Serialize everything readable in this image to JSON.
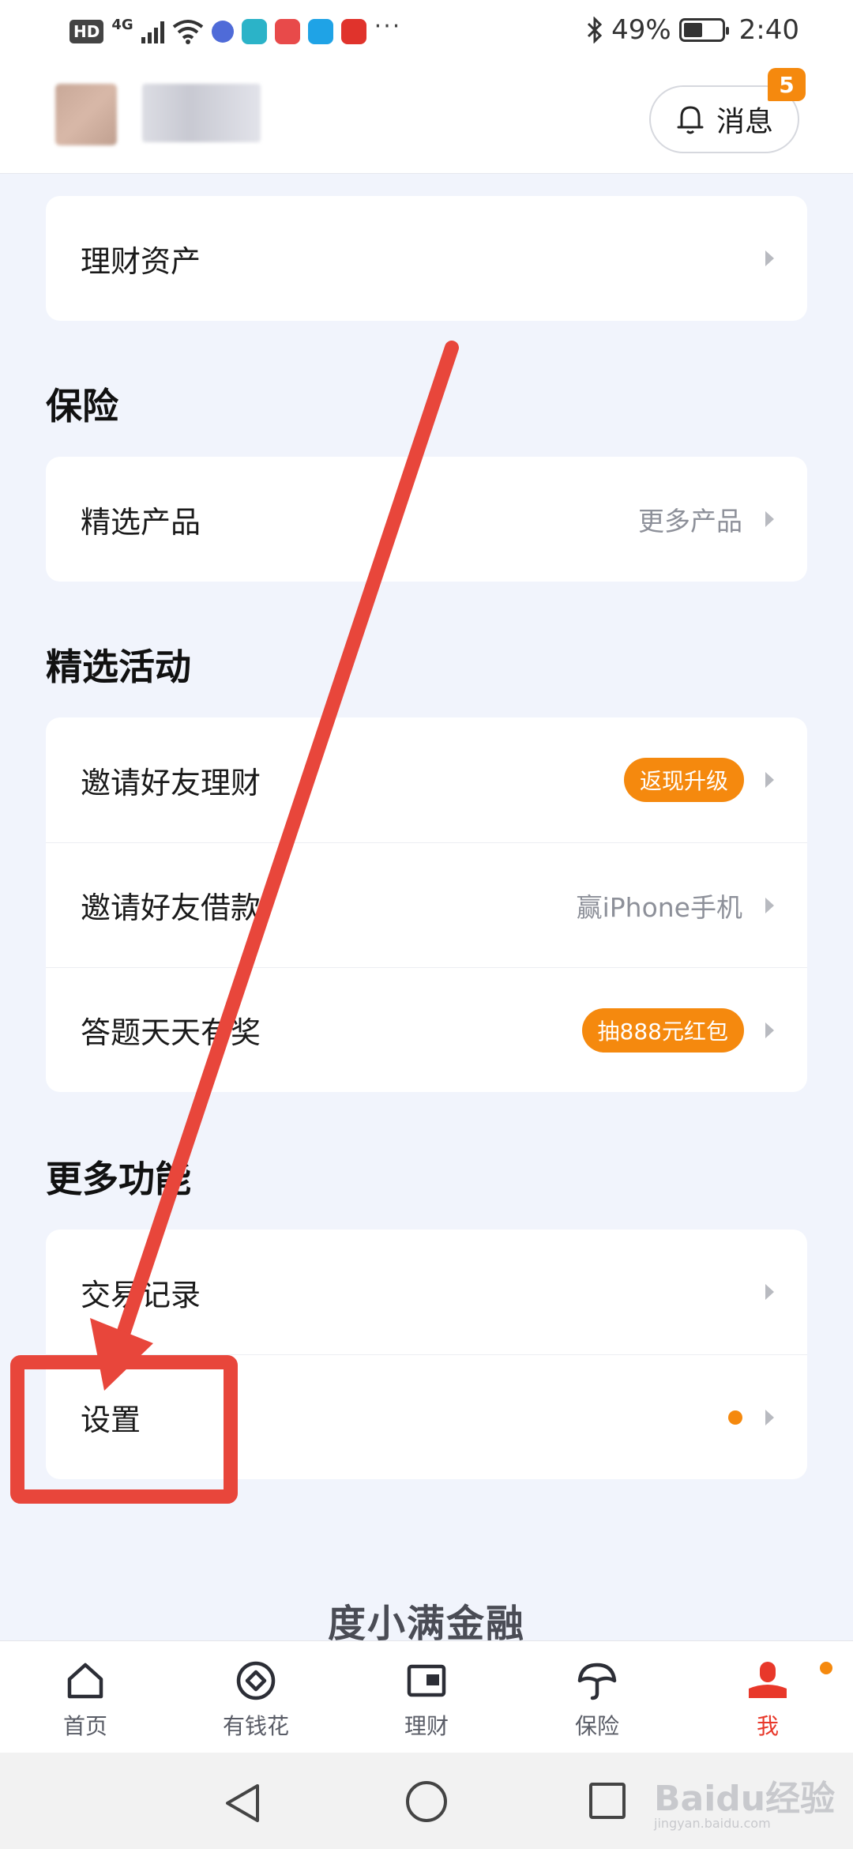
{
  "status_bar": {
    "hd": "HD",
    "network": "4G",
    "more": "···",
    "battery_text": "49%",
    "battery_level": 0.49,
    "time": "2:40"
  },
  "header": {
    "message_label": "消息",
    "message_badge": "5"
  },
  "sections": {
    "wealth": {
      "item_label": "理财资产"
    },
    "insurance": {
      "title": "保险",
      "item_label": "精选产品",
      "item_right": "更多产品"
    },
    "activities": {
      "title": "精选活动",
      "items": [
        {
          "label": "邀请好友理财",
          "pill": "返现升级"
        },
        {
          "label": "邀请好友借款",
          "right": "赢iPhone手机"
        },
        {
          "label": "答题天天有奖",
          "pill": "抽888元红包"
        }
      ]
    },
    "more": {
      "title": "更多功能",
      "items": [
        {
          "label": "交易记录"
        },
        {
          "label": "设置"
        }
      ]
    }
  },
  "footer_brand": "度小满金融",
  "tabs": [
    {
      "label": "首页",
      "icon": "home-icon"
    },
    {
      "label": "有钱花",
      "icon": "coin-icon"
    },
    {
      "label": "理财",
      "icon": "wallet-icon"
    },
    {
      "label": "保险",
      "icon": "umbrella-icon"
    },
    {
      "label": "我",
      "icon": "person-icon"
    }
  ],
  "watermark": {
    "brand": "Baidu经验",
    "url": "jingyan.baidu.com"
  },
  "colors": {
    "accent_orange": "#f5890e",
    "active_red": "#e8382a",
    "annotation_red": "#e8463b",
    "background": "#f1f4fc"
  }
}
